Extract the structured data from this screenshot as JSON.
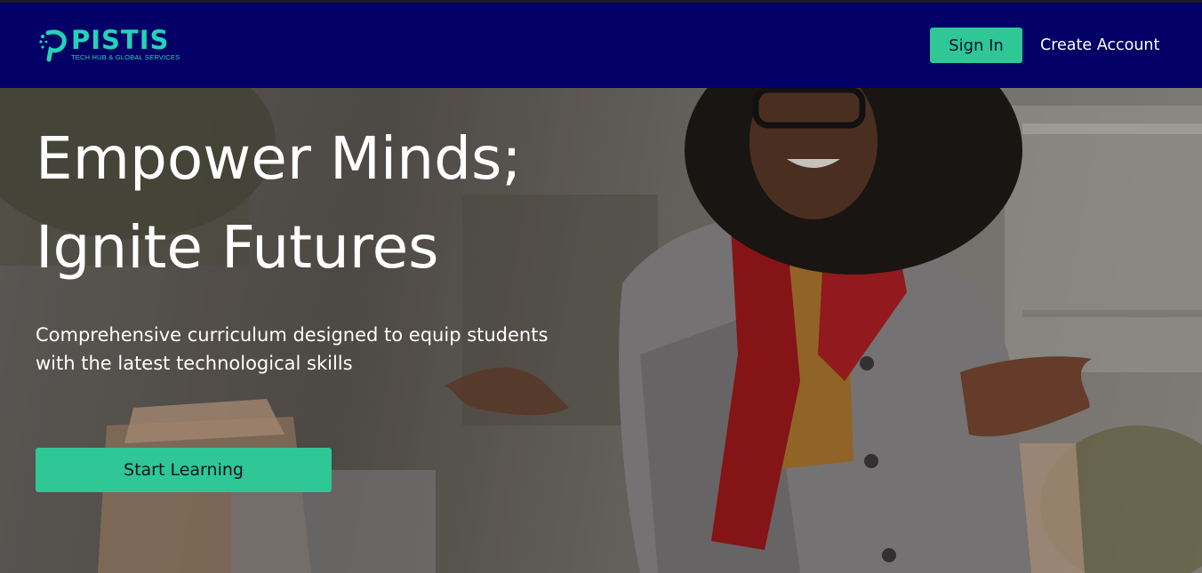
{
  "brand": {
    "name": "PISTIS",
    "tagline": "TECH HUB & GLOBAL SERVICES",
    "accent_color": "#24d3b6",
    "nav_bg_color": "#020066"
  },
  "nav": {
    "signin_label": "Sign In",
    "create_account_label": "Create Account",
    "button_color": "#2ec795"
  },
  "hero": {
    "title_line1": "Empower Minds;",
    "title_line2": "Ignite Futures",
    "subtitle_line1": "Comprehensive curriculum designed to equip students",
    "subtitle_line2": "with the latest technological skills",
    "cta_label": "Start Learning",
    "image_icon": "smiling-student-photo"
  }
}
